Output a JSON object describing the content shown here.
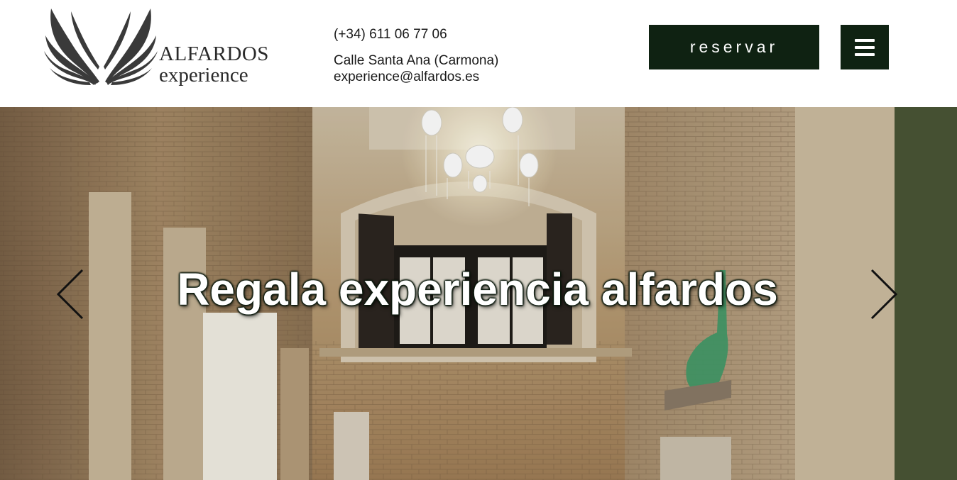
{
  "logo": {
    "title": "ALFARDOS",
    "subtitle": "experience",
    "icon": "wings-icon"
  },
  "contact": {
    "phone": "(+34) 611 06 77 06",
    "address": "Calle Santa Ana (Carmona)",
    "email": "experience@alfardos.es"
  },
  "header": {
    "reserve_label": "reservar",
    "menu_icon": "hamburger-menu-icon"
  },
  "hero": {
    "title": "Regala experiencia alfardos",
    "prev_icon": "chevron-left-icon",
    "next_icon": "chevron-right-icon"
  },
  "colors": {
    "accent": "#0f2212",
    "header_bg": "#ffffff"
  }
}
